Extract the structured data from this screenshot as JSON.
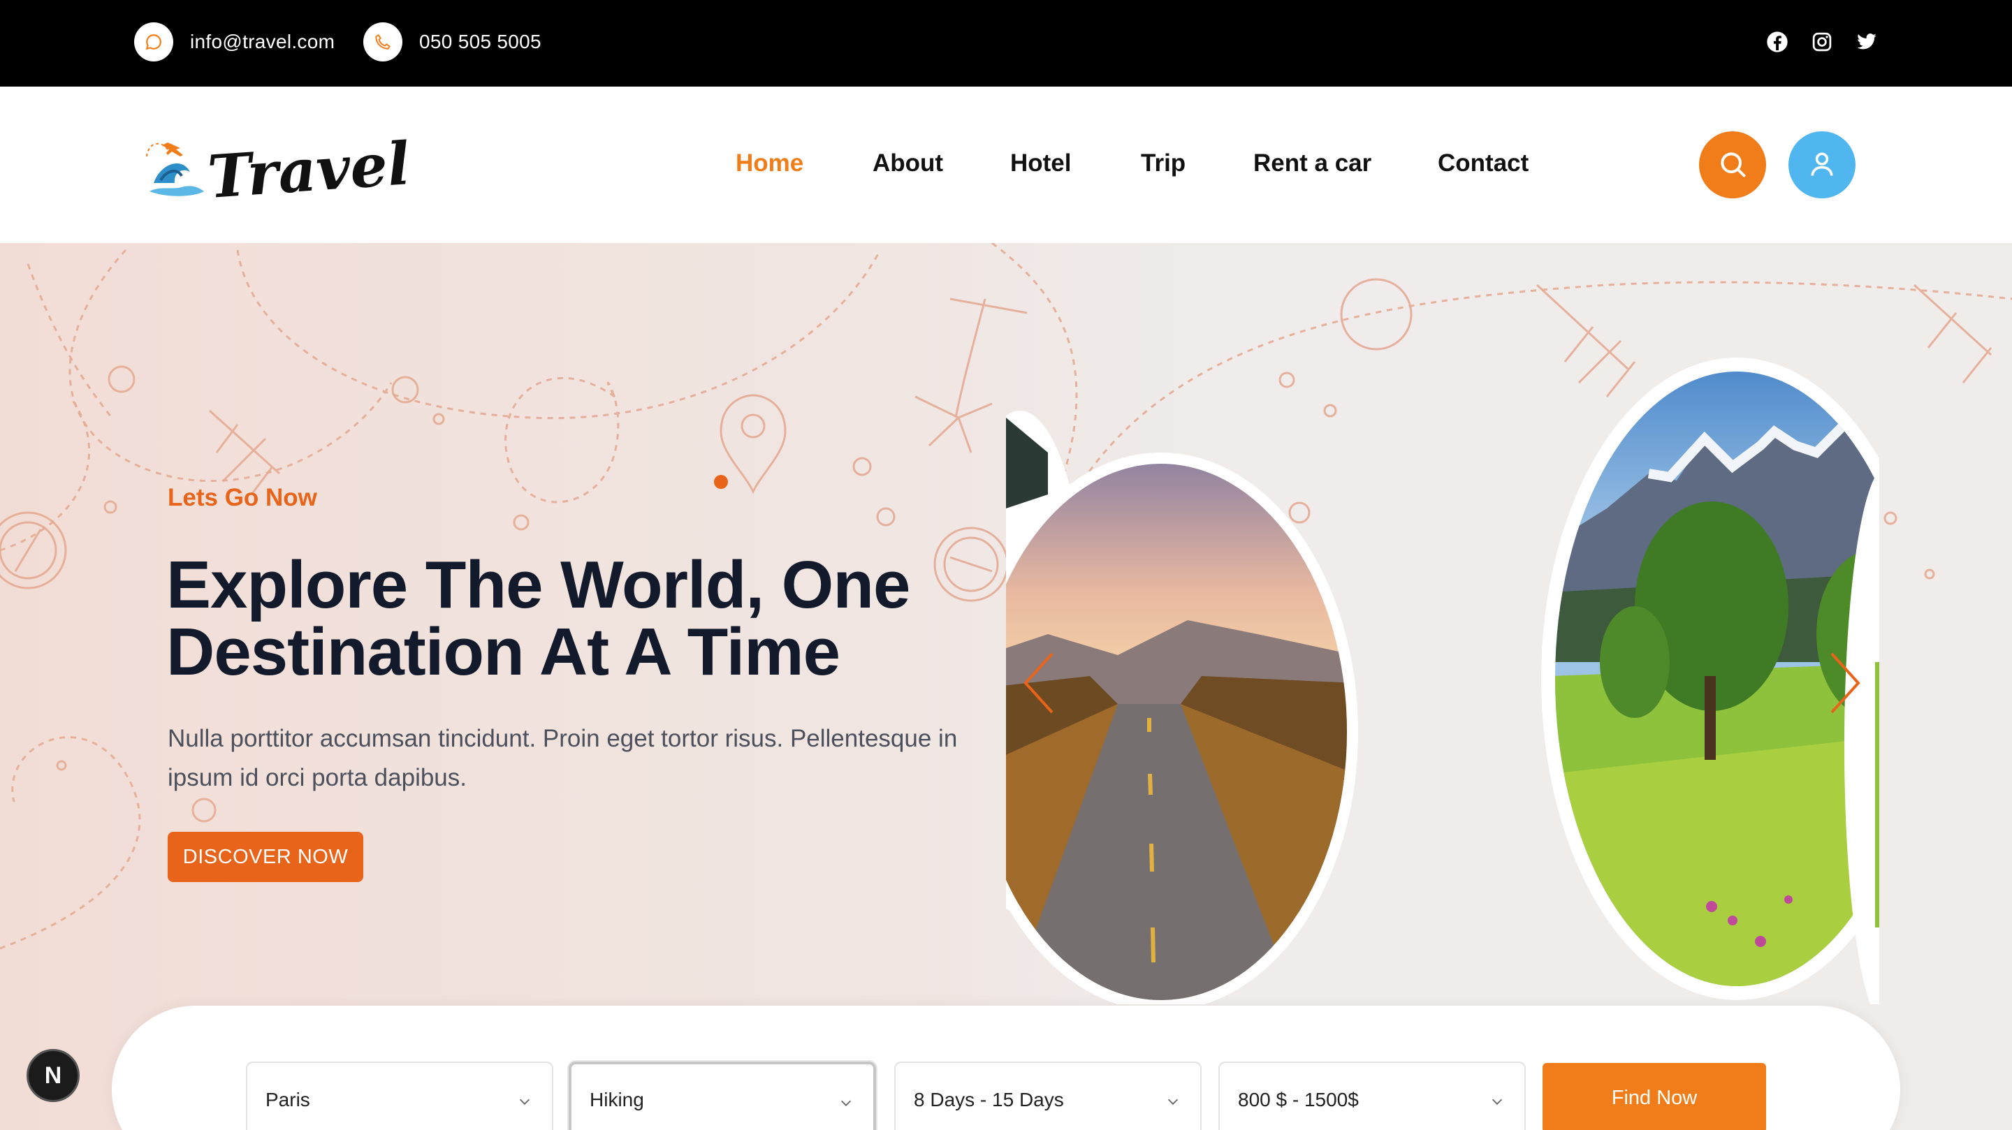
{
  "topbar": {
    "email": "info@travel.com",
    "phone": "050 505 5005",
    "social": [
      "facebook-icon",
      "instagram-icon",
      "twitter-icon"
    ]
  },
  "header": {
    "logo_text": "Travel",
    "nav": [
      {
        "label": "Home",
        "active": true
      },
      {
        "label": "About",
        "active": false
      },
      {
        "label": "Hotel",
        "active": false
      },
      {
        "label": "Trip",
        "active": false
      },
      {
        "label": "Rent a car",
        "active": false
      },
      {
        "label": "Contact",
        "active": false
      }
    ],
    "icons": [
      "search-icon",
      "user-icon"
    ]
  },
  "hero": {
    "eyebrow": "Lets Go Now",
    "title_line1": "Explore The World, One",
    "title_line2": "Destination At A Time",
    "description": "Nulla porttitor accumsan tincidunt. Proin eget tortor risus. Pellentesque in ipsum id orci porta dapibus.",
    "cta": "DISCOVER NOW"
  },
  "search": {
    "destination": "Paris",
    "activity": "Hiking",
    "duration": "8 Days - 15 Days",
    "price": "800 $ - 1500$",
    "submit": "Find Now"
  },
  "badge": "N",
  "colors": {
    "accent": "#f07d1a",
    "accent_dark": "#e8641a",
    "user_button": "#4fb6f0",
    "topbar": "#000000"
  }
}
